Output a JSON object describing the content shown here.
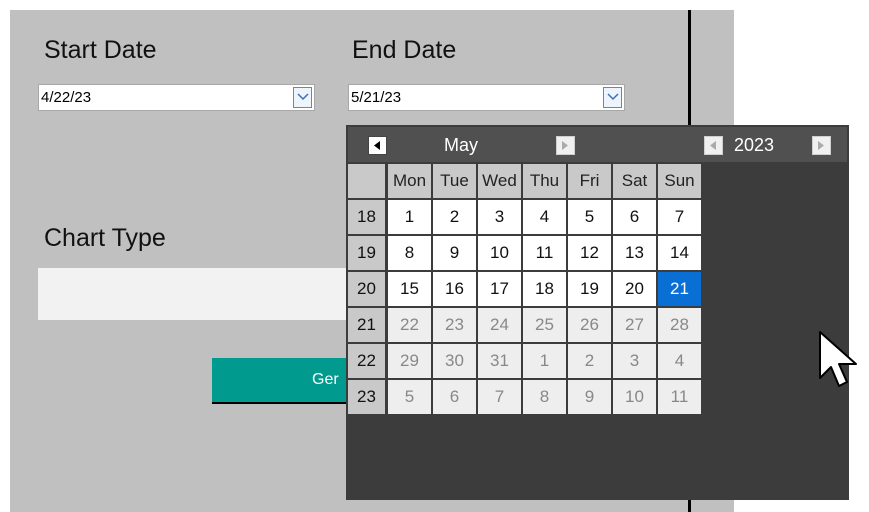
{
  "form": {
    "start_label": "Start Date",
    "start_value": "4/22/23",
    "end_label": "End Date",
    "end_value": "5/21/23",
    "chart_type_label": "Chart Type",
    "chart_type_value": "",
    "generate_label": "Ger"
  },
  "calendar": {
    "month": "May",
    "year": "2023",
    "weekdays": [
      "Mon",
      "Tue",
      "Wed",
      "Thu",
      "Fri",
      "Sat",
      "Sun"
    ],
    "weeks": [
      {
        "num": "18",
        "days": [
          {
            "d": "1",
            "s": "cur"
          },
          {
            "d": "2",
            "s": "cur"
          },
          {
            "d": "3",
            "s": "cur"
          },
          {
            "d": "4",
            "s": "cur"
          },
          {
            "d": "5",
            "s": "cur"
          },
          {
            "d": "6",
            "s": "cur"
          },
          {
            "d": "7",
            "s": "cur"
          }
        ]
      },
      {
        "num": "19",
        "days": [
          {
            "d": "8",
            "s": "cur"
          },
          {
            "d": "9",
            "s": "cur"
          },
          {
            "d": "10",
            "s": "cur"
          },
          {
            "d": "11",
            "s": "cur"
          },
          {
            "d": "12",
            "s": "cur"
          },
          {
            "d": "13",
            "s": "cur"
          },
          {
            "d": "14",
            "s": "cur"
          }
        ]
      },
      {
        "num": "20",
        "days": [
          {
            "d": "15",
            "s": "cur"
          },
          {
            "d": "16",
            "s": "cur"
          },
          {
            "d": "17",
            "s": "cur"
          },
          {
            "d": "18",
            "s": "cur"
          },
          {
            "d": "19",
            "s": "cur"
          },
          {
            "d": "20",
            "s": "cur"
          },
          {
            "d": "21",
            "s": "sel"
          }
        ]
      },
      {
        "num": "21",
        "days": [
          {
            "d": "22",
            "s": "oth"
          },
          {
            "d": "23",
            "s": "oth"
          },
          {
            "d": "24",
            "s": "oth"
          },
          {
            "d": "25",
            "s": "oth"
          },
          {
            "d": "26",
            "s": "oth"
          },
          {
            "d": "27",
            "s": "oth"
          },
          {
            "d": "28",
            "s": "oth"
          }
        ]
      },
      {
        "num": "22",
        "days": [
          {
            "d": "29",
            "s": "oth"
          },
          {
            "d": "30",
            "s": "oth"
          },
          {
            "d": "31",
            "s": "oth"
          },
          {
            "d": "1",
            "s": "oth"
          },
          {
            "d": "2",
            "s": "oth"
          },
          {
            "d": "3",
            "s": "oth"
          },
          {
            "d": "4",
            "s": "oth"
          }
        ]
      },
      {
        "num": "23",
        "days": [
          {
            "d": "5",
            "s": "oth"
          },
          {
            "d": "6",
            "s": "oth"
          },
          {
            "d": "7",
            "s": "oth"
          },
          {
            "d": "8",
            "s": "oth"
          },
          {
            "d": "9",
            "s": "oth"
          },
          {
            "d": "10",
            "s": "oth"
          },
          {
            "d": "11",
            "s": "oth"
          }
        ]
      }
    ]
  },
  "colors": {
    "accent": "#009a8e",
    "selected": "#0a6fd4"
  }
}
